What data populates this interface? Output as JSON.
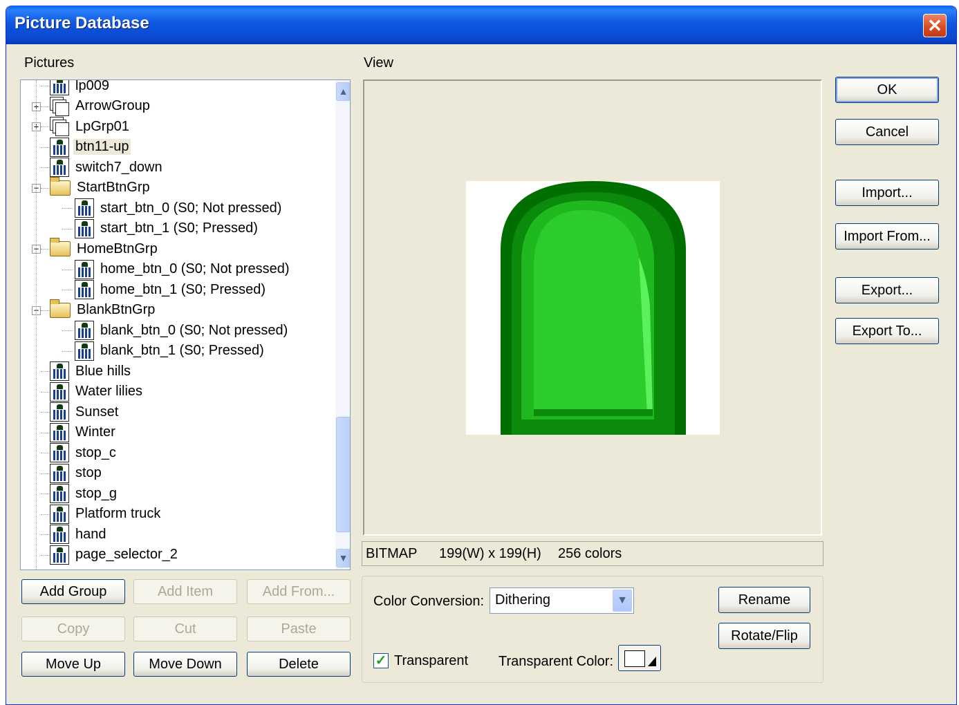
{
  "window": {
    "title": "Picture Database"
  },
  "labels": {
    "pictures": "Pictures",
    "view": "View"
  },
  "tree": {
    "items": [
      {
        "label": "lp009",
        "icon": "picture-icon"
      },
      {
        "label": "ArrowGroup",
        "icon": "picture-group-icon",
        "expander": "+"
      },
      {
        "label": "LpGrp01",
        "icon": "picture-group-icon",
        "expander": "+"
      },
      {
        "label": "btn11-up",
        "icon": "picture-icon",
        "selected": true
      },
      {
        "label": "switch7_down",
        "icon": "picture-icon"
      },
      {
        "label": "StartBtnGrp",
        "icon": "folder-open-icon",
        "expander": "−"
      },
      {
        "label": "start_btn_0 (S0; Not pressed)",
        "icon": "picture-icon"
      },
      {
        "label": "start_btn_1 (S0; Pressed)",
        "icon": "picture-icon"
      },
      {
        "label": "HomeBtnGrp",
        "icon": "folder-open-icon",
        "expander": "−"
      },
      {
        "label": "home_btn_0 (S0; Not pressed)",
        "icon": "picture-icon"
      },
      {
        "label": "home_btn_1 (S0; Pressed)",
        "icon": "picture-icon"
      },
      {
        "label": "BlankBtnGrp",
        "icon": "folder-open-icon",
        "expander": "−"
      },
      {
        "label": "blank_btn_0 (S0; Not pressed)",
        "icon": "picture-icon"
      },
      {
        "label": "blank_btn_1 (S0; Pressed)",
        "icon": "picture-icon"
      },
      {
        "label": "Blue hills",
        "icon": "picture-icon"
      },
      {
        "label": "Water lilies",
        "icon": "picture-icon"
      },
      {
        "label": "Sunset",
        "icon": "picture-icon"
      },
      {
        "label": "Winter",
        "icon": "picture-icon"
      },
      {
        "label": "stop_c",
        "icon": "picture-icon"
      },
      {
        "label": "stop",
        "icon": "picture-icon"
      },
      {
        "label": "stop_g",
        "icon": "picture-icon"
      },
      {
        "label": "Platform truck",
        "icon": "picture-icon"
      },
      {
        "label": "hand",
        "icon": "picture-icon"
      },
      {
        "label": "page_selector_2",
        "icon": "picture-icon"
      }
    ]
  },
  "tree_buttons": {
    "add_group": "Add Group",
    "add_item": "Add Item",
    "add_from": "Add From...",
    "copy": "Copy",
    "cut": "Cut",
    "paste": "Paste",
    "move_up": "Move Up",
    "move_down": "Move Down",
    "delete": "Delete"
  },
  "side_buttons": {
    "ok": "OK",
    "cancel": "Cancel",
    "import": "Import...",
    "import_from": "Import From...",
    "export": "Export...",
    "export_to": "Export To..."
  },
  "info": {
    "type": "BITMAP",
    "size": "199(W) x 199(H)",
    "colors": "256 colors"
  },
  "options": {
    "color_conversion_label": "Color Conversion:",
    "color_conversion_value": "Dithering",
    "transparent_label": "Transparent",
    "transparent_checked": true,
    "transparent_color_label": "Transparent Color:",
    "transparent_color": "#ffffff",
    "rename": "Rename",
    "rotate_flip": "Rotate/Flip"
  },
  "colors": {
    "title_bar": "#0a57e0",
    "dialog_bg": "#ece9d8",
    "preview_dark_green": "#006400",
    "preview_mid_green": "#1a9a1a",
    "preview_light_green": "#2ecc2e"
  }
}
